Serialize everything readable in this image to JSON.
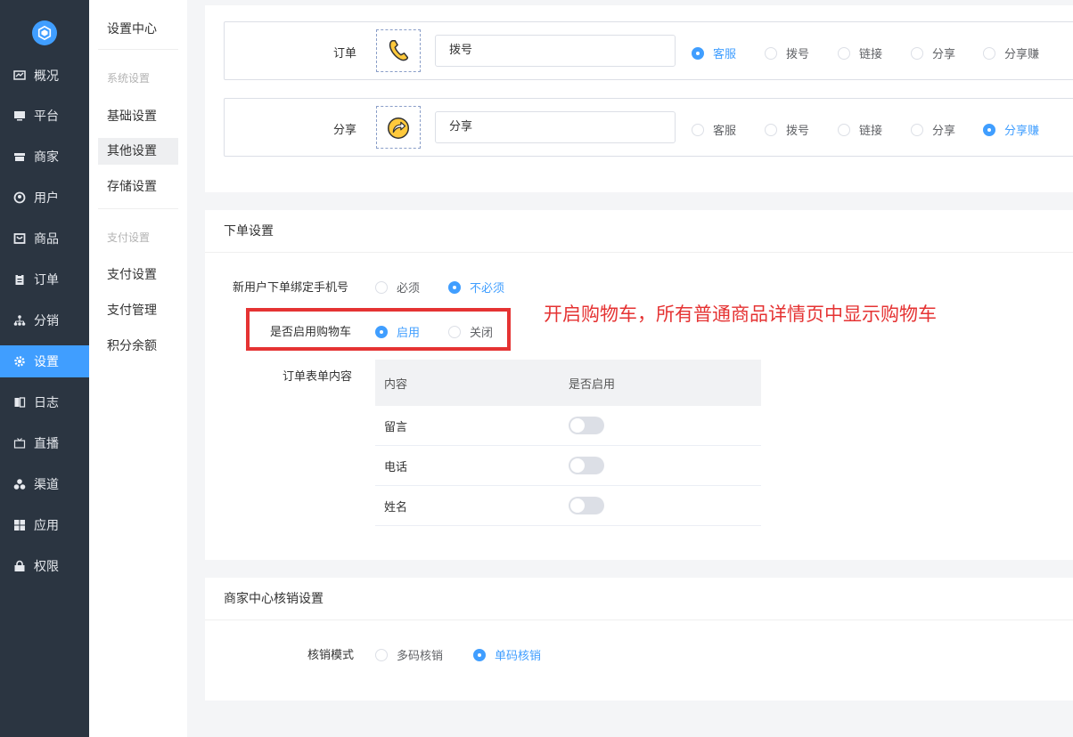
{
  "sidebar": {
    "items": [
      {
        "label": "概况",
        "icon": "dashboard-icon"
      },
      {
        "label": "平台",
        "icon": "monitor-icon"
      },
      {
        "label": "商家",
        "icon": "store-icon"
      },
      {
        "label": "用户",
        "icon": "user-icon"
      },
      {
        "label": "商品",
        "icon": "goods-icon"
      },
      {
        "label": "订单",
        "icon": "clipboard-icon"
      },
      {
        "label": "分销",
        "icon": "network-icon"
      },
      {
        "label": "设置",
        "icon": "gear-icon"
      },
      {
        "label": "日志",
        "icon": "book-icon"
      },
      {
        "label": "直播",
        "icon": "tv-icon"
      },
      {
        "label": "渠道",
        "icon": "cluster-icon"
      },
      {
        "label": "应用",
        "icon": "grid-icon"
      },
      {
        "label": "权限",
        "icon": "lock-icon"
      }
    ],
    "active_index": 7
  },
  "subnav": {
    "title": "设置中心",
    "group1": "系统设置",
    "basic": "基础设置",
    "other": "其他设置",
    "storage": "存储设置",
    "group2": "支付设置",
    "pay_settings": "支付设置",
    "pay_manage": "支付管理",
    "points": "积分余额"
  },
  "menu_rows": [
    {
      "label": "订单",
      "icon": "phone-icon",
      "value": "拨号",
      "options": [
        "客服",
        "拨号",
        "链接",
        "分享",
        "分享赚"
      ],
      "selected": 0
    },
    {
      "label": "分享",
      "icon": "share-icon",
      "value": "分享",
      "options": [
        "客服",
        "拨号",
        "链接",
        "分享",
        "分享赚"
      ],
      "selected": 4
    }
  ],
  "order_settings": {
    "title": "下单设置",
    "bind_phone_label": "新用户下单绑定手机号",
    "bind_phone_options": [
      "必须",
      "不必须"
    ],
    "bind_phone_selected": 1,
    "cart_label": "是否启用购物车",
    "cart_options": [
      "启用",
      "关闭"
    ],
    "cart_selected": 0,
    "form_label": "订单表单内容",
    "table": {
      "headers": [
        "内容",
        "是否启用"
      ],
      "rows": [
        "留言",
        "电话",
        "姓名"
      ]
    }
  },
  "annotation": "开启购物车，所有普通商品详情页中显示购物车",
  "verify_settings": {
    "title": "商家中心核销设置",
    "mode_label": "核销模式",
    "options": [
      "多码核销",
      "单码核销"
    ],
    "selected": 1
  },
  "colors": {
    "accent": "#409eff",
    "sidebar": "#2b3541",
    "annotation": "#e53333"
  }
}
